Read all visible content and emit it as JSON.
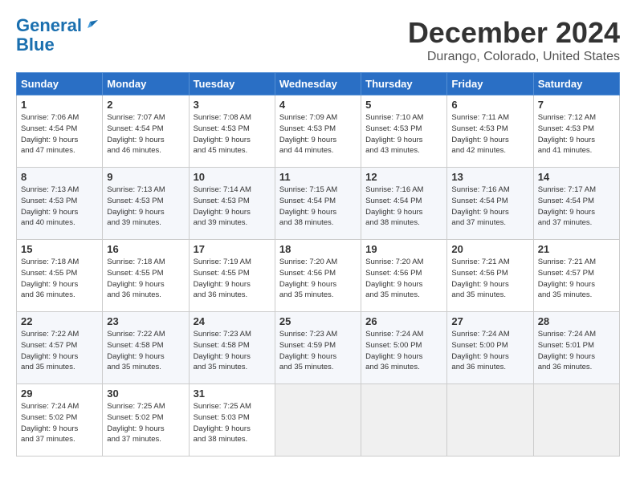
{
  "logo": {
    "line1": "General",
    "line2": "Blue"
  },
  "title": "December 2024",
  "location": "Durango, Colorado, United States",
  "weekdays": [
    "Sunday",
    "Monday",
    "Tuesday",
    "Wednesday",
    "Thursday",
    "Friday",
    "Saturday"
  ],
  "weeks": [
    [
      {
        "day": "1",
        "rise": "7:06 AM",
        "set": "4:54 PM",
        "daylight": "9 hours and 47 minutes."
      },
      {
        "day": "2",
        "rise": "7:07 AM",
        "set": "4:54 PM",
        "daylight": "9 hours and 46 minutes."
      },
      {
        "day": "3",
        "rise": "7:08 AM",
        "set": "4:53 PM",
        "daylight": "9 hours and 45 minutes."
      },
      {
        "day": "4",
        "rise": "7:09 AM",
        "set": "4:53 PM",
        "daylight": "9 hours and 44 minutes."
      },
      {
        "day": "5",
        "rise": "7:10 AM",
        "set": "4:53 PM",
        "daylight": "9 hours and 43 minutes."
      },
      {
        "day": "6",
        "rise": "7:11 AM",
        "set": "4:53 PM",
        "daylight": "9 hours and 42 minutes."
      },
      {
        "day": "7",
        "rise": "7:12 AM",
        "set": "4:53 PM",
        "daylight": "9 hours and 41 minutes."
      }
    ],
    [
      {
        "day": "8",
        "rise": "7:13 AM",
        "set": "4:53 PM",
        "daylight": "9 hours and 40 minutes."
      },
      {
        "day": "9",
        "rise": "7:13 AM",
        "set": "4:53 PM",
        "daylight": "9 hours and 39 minutes."
      },
      {
        "day": "10",
        "rise": "7:14 AM",
        "set": "4:53 PM",
        "daylight": "9 hours and 39 minutes."
      },
      {
        "day": "11",
        "rise": "7:15 AM",
        "set": "4:54 PM",
        "daylight": "9 hours and 38 minutes."
      },
      {
        "day": "12",
        "rise": "7:16 AM",
        "set": "4:54 PM",
        "daylight": "9 hours and 38 minutes."
      },
      {
        "day": "13",
        "rise": "7:16 AM",
        "set": "4:54 PM",
        "daylight": "9 hours and 37 minutes."
      },
      {
        "day": "14",
        "rise": "7:17 AM",
        "set": "4:54 PM",
        "daylight": "9 hours and 37 minutes."
      }
    ],
    [
      {
        "day": "15",
        "rise": "7:18 AM",
        "set": "4:55 PM",
        "daylight": "9 hours and 36 minutes."
      },
      {
        "day": "16",
        "rise": "7:18 AM",
        "set": "4:55 PM",
        "daylight": "9 hours and 36 minutes."
      },
      {
        "day": "17",
        "rise": "7:19 AM",
        "set": "4:55 PM",
        "daylight": "9 hours and 36 minutes."
      },
      {
        "day": "18",
        "rise": "7:20 AM",
        "set": "4:56 PM",
        "daylight": "9 hours and 35 minutes."
      },
      {
        "day": "19",
        "rise": "7:20 AM",
        "set": "4:56 PM",
        "daylight": "9 hours and 35 minutes."
      },
      {
        "day": "20",
        "rise": "7:21 AM",
        "set": "4:56 PM",
        "daylight": "9 hours and 35 minutes."
      },
      {
        "day": "21",
        "rise": "7:21 AM",
        "set": "4:57 PM",
        "daylight": "9 hours and 35 minutes."
      }
    ],
    [
      {
        "day": "22",
        "rise": "7:22 AM",
        "set": "4:57 PM",
        "daylight": "9 hours and 35 minutes."
      },
      {
        "day": "23",
        "rise": "7:22 AM",
        "set": "4:58 PM",
        "daylight": "9 hours and 35 minutes."
      },
      {
        "day": "24",
        "rise": "7:23 AM",
        "set": "4:58 PM",
        "daylight": "9 hours and 35 minutes."
      },
      {
        "day": "25",
        "rise": "7:23 AM",
        "set": "4:59 PM",
        "daylight": "9 hours and 35 minutes."
      },
      {
        "day": "26",
        "rise": "7:24 AM",
        "set": "5:00 PM",
        "daylight": "9 hours and 36 minutes."
      },
      {
        "day": "27",
        "rise": "7:24 AM",
        "set": "5:00 PM",
        "daylight": "9 hours and 36 minutes."
      },
      {
        "day": "28",
        "rise": "7:24 AM",
        "set": "5:01 PM",
        "daylight": "9 hours and 36 minutes."
      }
    ],
    [
      {
        "day": "29",
        "rise": "7:24 AM",
        "set": "5:02 PM",
        "daylight": "9 hours and 37 minutes."
      },
      {
        "day": "30",
        "rise": "7:25 AM",
        "set": "5:02 PM",
        "daylight": "9 hours and 37 minutes."
      },
      {
        "day": "31",
        "rise": "7:25 AM",
        "set": "5:03 PM",
        "daylight": "9 hours and 38 minutes."
      },
      null,
      null,
      null,
      null
    ]
  ]
}
